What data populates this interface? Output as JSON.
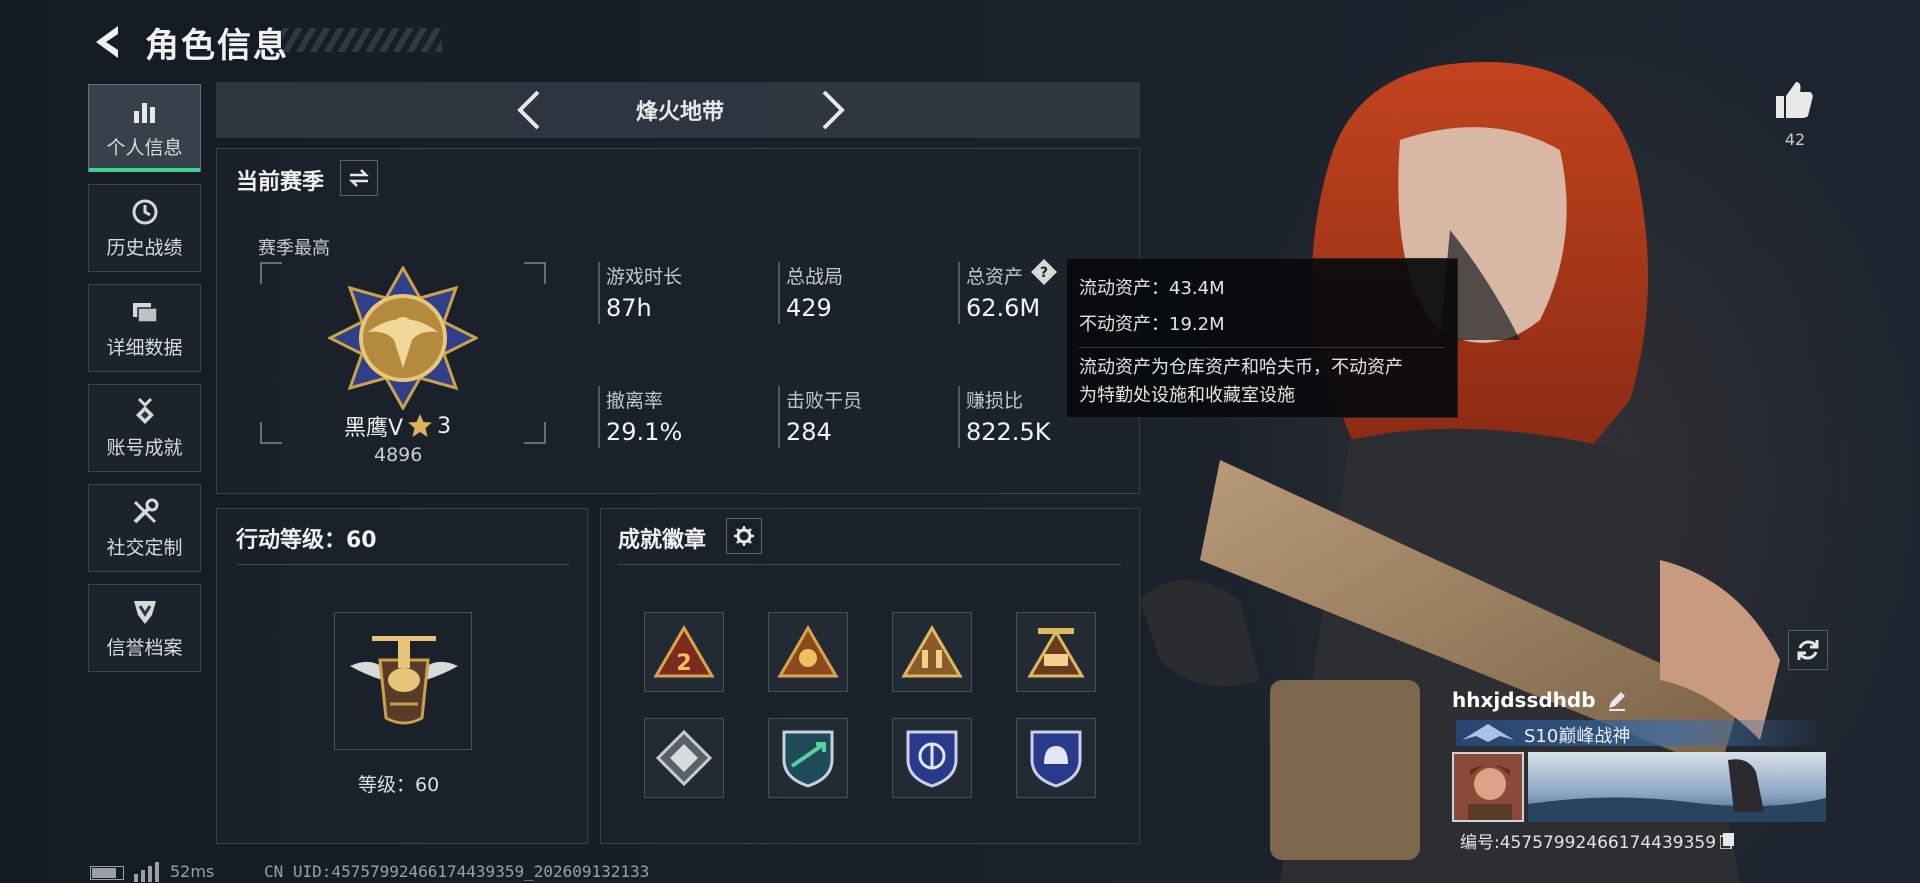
{
  "header": {
    "title": "角色信息"
  },
  "nav": {
    "items": [
      {
        "label": "个人信息",
        "icon": "bar-chart-icon",
        "active": true
      },
      {
        "label": "历史战绩",
        "icon": "clock-history-icon"
      },
      {
        "label": "详细数据",
        "icon": "folders-icon"
      },
      {
        "label": "账号成就",
        "icon": "medal-icon"
      },
      {
        "label": "社交定制",
        "icon": "tools-icon"
      },
      {
        "label": "信誉档案",
        "icon": "shield-icon"
      }
    ]
  },
  "mode": {
    "title": "烽火地带"
  },
  "season": {
    "title": "当前赛季",
    "best_label": "赛季最高",
    "rank_name": "黑鹰Ⅴ",
    "rank_stars": "3",
    "rank_score": "4896",
    "stats": [
      {
        "label": "游戏时长",
        "value": "87h"
      },
      {
        "label": "总战局",
        "value": "429"
      },
      {
        "label": "总资产",
        "value": "62.6M"
      },
      {
        "label": "撤离率",
        "value": "29.1%"
      },
      {
        "label": "击败干员",
        "value": "284"
      },
      {
        "label": "赚损比",
        "value": "822.5K"
      }
    ]
  },
  "tooltip": {
    "liquid": "流动资产：43.4M",
    "fixed": "不动资产：19.2M",
    "desc_line1": "流动资产为仓库资产和哈夫币，不动资产",
    "desc_line2": "为特勤处设施和收藏室设施"
  },
  "action": {
    "title": "行动等级：60",
    "level_label": "等级：60"
  },
  "badges": {
    "title": "成就徽章",
    "items": [
      {
        "icon": "triangle-badge-2-icon"
      },
      {
        "icon": "triangle-badge-hands-icon"
      },
      {
        "icon": "triangle-badge-soldiers-icon"
      },
      {
        "icon": "triangle-badge-tank-icon"
      },
      {
        "icon": "diamond-badge-icon"
      },
      {
        "icon": "shield-badge-arrows-icon"
      },
      {
        "icon": "shield-badge-emblem-icon"
      },
      {
        "icon": "shield-badge-helmet-icon"
      }
    ]
  },
  "profile": {
    "likes": "42",
    "name": "hhxjdssdhdb",
    "title": "S10巅峰战神",
    "id": "编号:4575799246617443935​9"
  },
  "footer": {
    "ping": "52ms",
    "uid": "CN UID:4575799246617443935​9_202609132133"
  },
  "colors": {
    "accent": "#3ed08c",
    "gold": "#c9a24a",
    "panel": "#1c232c"
  }
}
